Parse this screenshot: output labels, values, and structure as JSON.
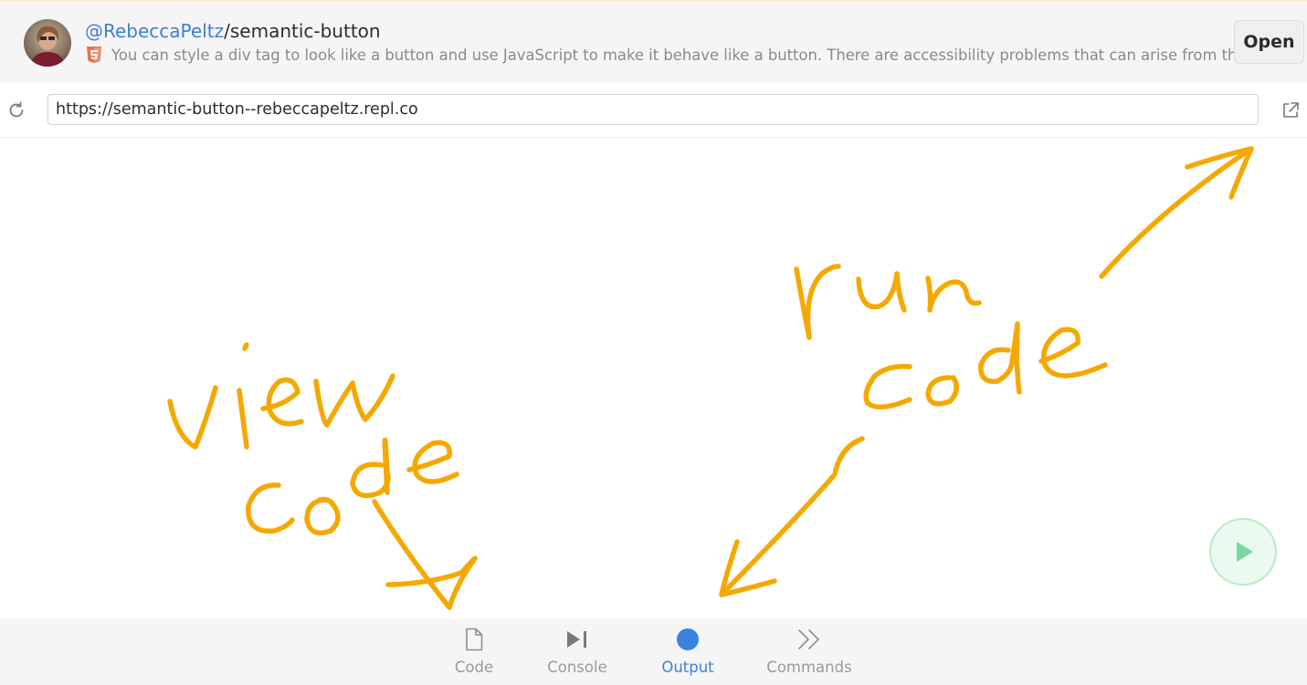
{
  "header": {
    "user": "@RebeccaPeltz",
    "separator": "/",
    "repl_name": "semantic-button",
    "description": "You can style a div tag to look like a button and use JavaScript to make it behave like a button. There are accessibility problems that can arise from this.",
    "language_icon": "html5-icon",
    "open_label": "Open"
  },
  "url_bar": {
    "refresh_icon": "refresh-icon",
    "url": "https://semantic-button--rebeccapeltz.repl.co",
    "external_icon": "external-link-icon"
  },
  "run_button": {
    "icon": "play-icon",
    "color": "#7ed6a0"
  },
  "bottom_nav": {
    "tabs": [
      {
        "label": "Code",
        "icon": "file-icon",
        "active": false
      },
      {
        "label": "Console",
        "icon": "console-icon",
        "active": false
      },
      {
        "label": "Output",
        "icon": "output-dot-icon",
        "active": true
      },
      {
        "label": "Commands",
        "icon": "chevrons-icon",
        "active": false
      }
    ],
    "active_color": "#3a82df"
  },
  "annotations": {
    "color": "#f5a800",
    "view_code": "view code",
    "run_code": "run code"
  }
}
